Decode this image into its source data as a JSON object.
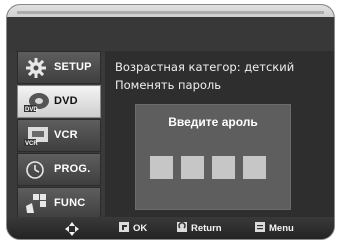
{
  "menu": {
    "items": [
      {
        "label": "SETUP",
        "icon": "gear-icon",
        "active": false
      },
      {
        "label": "DVD",
        "icon": "dvd-disc-icon",
        "active": true
      },
      {
        "label": "VCR",
        "icon": "vcr-cassette-icon",
        "active": false
      },
      {
        "label": "PROG.",
        "icon": "clock-icon",
        "active": false
      },
      {
        "label": "FUNC",
        "icon": "function-grid-icon",
        "active": false
      }
    ]
  },
  "content": {
    "parental_line": "Возрастная категор: детский",
    "change_password": "Поменять пароль",
    "dialog_title": "Введите  ароль",
    "pin_digits": 4
  },
  "footer": {
    "move_icon": "dpad-icon",
    "ok_label": "OK",
    "return_label": "Return",
    "menu_label": "Menu"
  }
}
